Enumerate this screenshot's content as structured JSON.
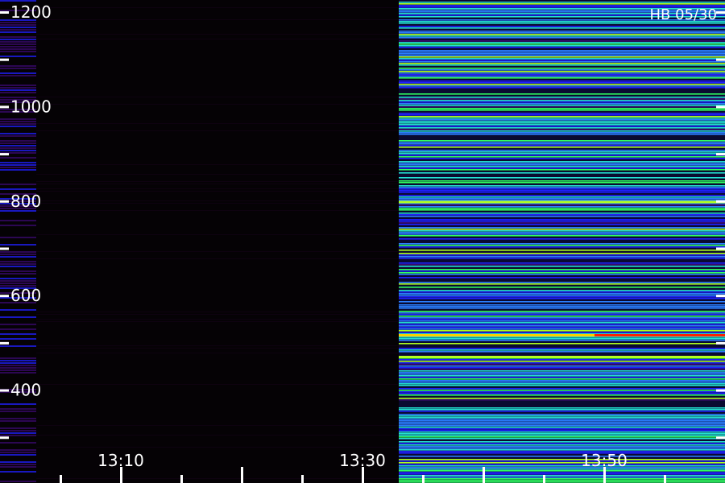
{
  "chart_data": {
    "type": "heatmap",
    "title": "",
    "annotation": "HB 05/30",
    "xlabel": "",
    "ylabel": "",
    "y_ticks": [
      {
        "label": "1200",
        "value": 1200
      },
      {
        "label": "1000",
        "value": 1000
      },
      {
        "label": "800",
        "value": 800
      },
      {
        "label": "600",
        "value": 600
      },
      {
        "label": "400",
        "value": 400
      }
    ],
    "y_range": [
      280,
      1200
    ],
    "x_ticks": [
      {
        "label": "13:10",
        "value": "13:10"
      },
      {
        "label": "13:30",
        "value": "13:30"
      },
      {
        "label": "13:50",
        "value": "13:50"
      }
    ],
    "x_range": [
      "13:00",
      "14:00"
    ],
    "colormap": [
      "#3a0a6e",
      "#2020ff",
      "#2a7fff",
      "#22e0d0",
      "#30ff60",
      "#b0ff20",
      "#ffd000",
      "#ff2000"
    ],
    "segments": [
      {
        "t_start": "13:00",
        "t_end": "13:03",
        "level": "low"
      },
      {
        "t_start": "13:03",
        "t_end": "13:33",
        "level": "none"
      },
      {
        "t_start": "13:33",
        "t_end": "14:00",
        "level": "high"
      }
    ],
    "strong_features": [
      {
        "y": 516,
        "intensity": "max"
      },
      {
        "y": 470,
        "intensity": "high"
      },
      {
        "y": 798,
        "intensity": "high"
      }
    ]
  }
}
